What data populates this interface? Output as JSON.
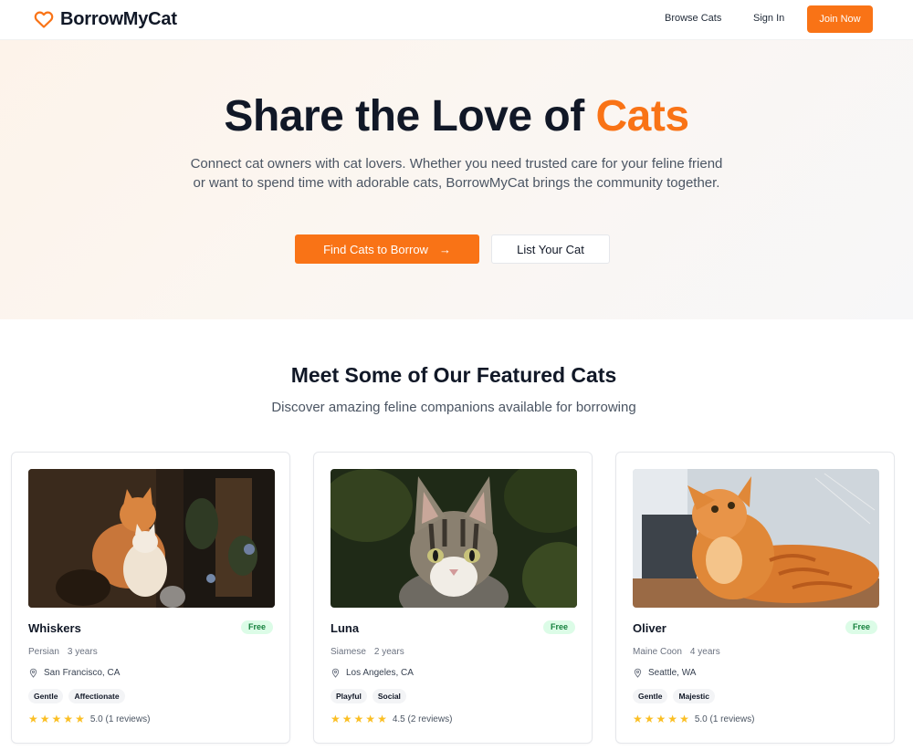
{
  "nav": {
    "brand": "BorrowMyCat",
    "links": [
      "Browse Cats",
      "Sign In"
    ],
    "cta": "Join Now"
  },
  "hero": {
    "title_main": "Share the Love of ",
    "title_accent": "Cats",
    "subtitle": "Connect cat owners with cat lovers. Whether you need trusted care for your feline friend or want to spend time with adorable cats, BorrowMyCat brings the community together.",
    "primary_button": "Find Cats to Borrow",
    "secondary_button": "List Your Cat"
  },
  "featured": {
    "title": "Meet Some of Our Featured Cats",
    "subtitle": "Discover amazing feline companions available for borrowing",
    "cards": [
      {
        "name": "Whiskers",
        "badge": "Free",
        "breed": "Persian",
        "age": "3 years",
        "location": "San Francisco, CA",
        "tags": [
          "Gentle",
          "Affectionate"
        ],
        "rating": 5.0,
        "rating_text": "5.0 (1 reviews)"
      },
      {
        "name": "Luna",
        "badge": "Free",
        "breed": "Siamese",
        "age": "2 years",
        "location": "Los Angeles, CA",
        "tags": [
          "Playful",
          "Social"
        ],
        "rating": 4.5,
        "rating_text": "4.5 (2 reviews)"
      },
      {
        "name": "Oliver",
        "badge": "Free",
        "breed": "Maine Coon",
        "age": "4 years",
        "location": "Seattle, WA",
        "tags": [
          "Gentle",
          "Majestic"
        ],
        "rating": 5.0,
        "rating_text": "5.0 (1 reviews)"
      }
    ]
  },
  "colors": {
    "accent": "#f97316",
    "star": "#fbbf24",
    "badge_bg": "#dcfce7",
    "badge_text": "#15803d"
  },
  "icons": {
    "logo": "heart-outline-icon",
    "arrow": "arrow-right-icon",
    "location": "map-pin-icon",
    "rating": "star-icon"
  }
}
